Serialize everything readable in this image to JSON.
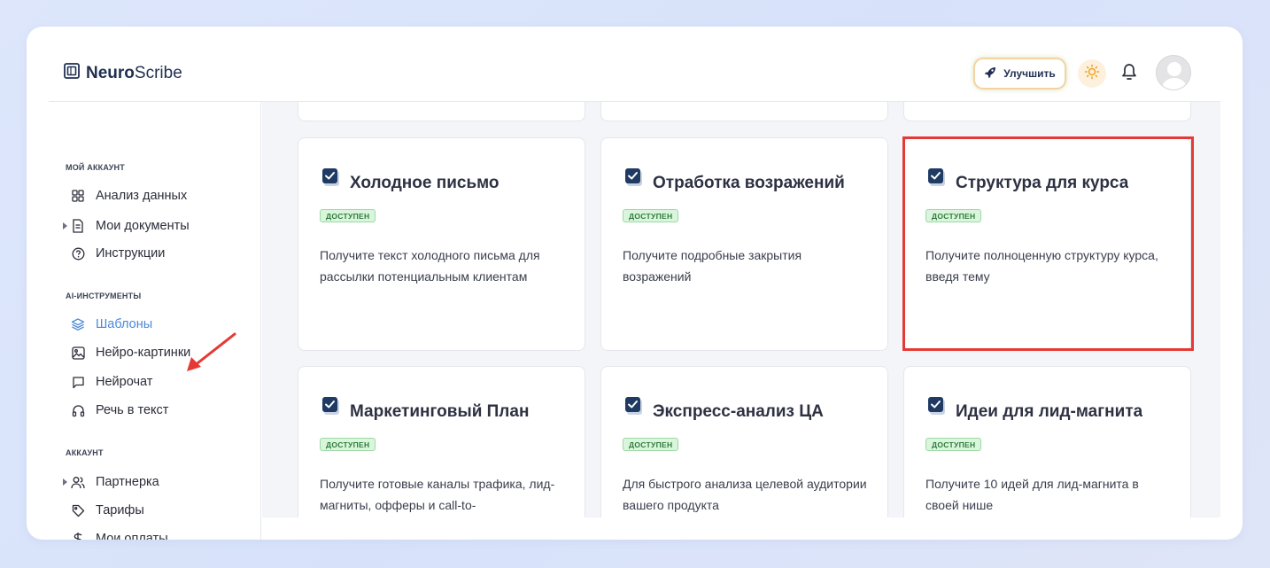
{
  "app": {
    "logo_bold": "Neuro",
    "logo_light": "Scribe"
  },
  "header": {
    "upgrade_label": "Улучшить",
    "theme_icon": "sun-icon",
    "notifications_icon": "bell-icon",
    "avatar_icon": "user-avatar-icon"
  },
  "sidebar": {
    "sections": [
      {
        "title": "МОЙ АККАУНТ"
      },
      {
        "title": "AI-ИНСТРУМЕНТЫ"
      },
      {
        "title": "АККАУНТ"
      }
    ],
    "items": [
      {
        "label": "Анализ данных",
        "icon": "grid-icon"
      },
      {
        "label": "Мои документы",
        "icon": "document-icon",
        "expandable": true
      },
      {
        "label": "Инструкции",
        "icon": "help-circle-icon"
      },
      {
        "label": "Шаблоны",
        "icon": "layers-icon",
        "active": true
      },
      {
        "label": "Нейро-картинки",
        "icon": "image-icon"
      },
      {
        "label": "Нейрочат",
        "icon": "chat-icon"
      },
      {
        "label": "Речь в текст",
        "icon": "headphones-icon"
      },
      {
        "label": "Партнерка",
        "icon": "users-icon",
        "expandable": true
      },
      {
        "label": "Тарифы",
        "icon": "tag-icon"
      },
      {
        "label": "Мои оплаты",
        "icon": "dollar-icon"
      }
    ]
  },
  "cards": [
    {
      "title": "Холодное письмо",
      "badge": "ДОСТУПЕН",
      "description": "Получите текст холодного письма для рассылки потенциальным клиентам"
    },
    {
      "title": "Отработка возражений",
      "badge": "ДОСТУПЕН",
      "description": "Получите подробные закрытия возражений"
    },
    {
      "title": "Структура для курса",
      "badge": "ДОСТУПЕН",
      "description": "Получите полноценную структуру курса, введя тему"
    },
    {
      "title": "Маркетинговый План",
      "badge": "ДОСТУПЕН",
      "description": "Получите готовые каналы трафика, лид-магниты, офферы и call-to-"
    },
    {
      "title": "Экспресс-анализ ЦА",
      "badge": "ДОСТУПЕН",
      "description": "Для быстрого анализа целевой аудитории вашего продукта"
    },
    {
      "title": "Идеи для лид-магнита",
      "badge": "ДОСТУПЕН",
      "description": "Получите 10 идей для лид-магнита в своей нише"
    }
  ],
  "colors": {
    "accent": "#4b89d9",
    "badge_bg": "#d9f5dc",
    "highlight": "#e53935",
    "card_icon": "#1f3b63"
  }
}
